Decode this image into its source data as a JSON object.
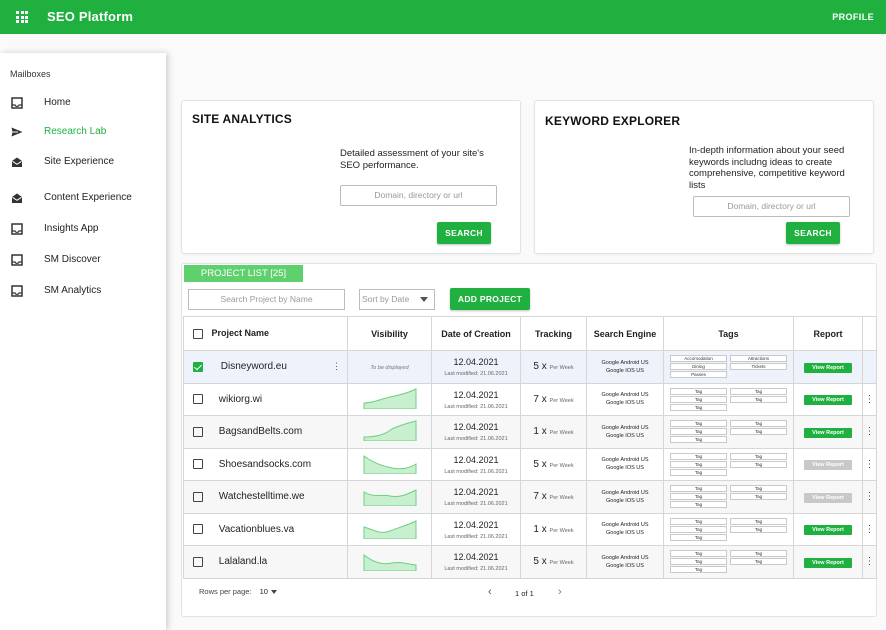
{
  "header": {
    "title": "SEO Platform",
    "profile": "PROFILE"
  },
  "sidebar": {
    "section": "Mailboxes",
    "items": [
      {
        "label": "Home",
        "icon": "inbox-icon"
      },
      {
        "label": "Research Lab",
        "icon": "send-icon",
        "active": true
      },
      {
        "label": "Site Experience",
        "icon": "drafts-icon"
      },
      {
        "label": "Content Experience",
        "icon": "drafts-icon"
      },
      {
        "label": "Insights App",
        "icon": "inbox-icon"
      },
      {
        "label": "SM Discover",
        "icon": "inbox-icon"
      },
      {
        "label": "SM Analytics",
        "icon": "inbox-icon"
      }
    ]
  },
  "site_analytics": {
    "title": "SITE ANALYTICS",
    "description": "Detailed assessment of your site's SEO performance.",
    "placeholder": "Domain, directory or url",
    "button": "SEARCH"
  },
  "keyword_explorer": {
    "title": "KEYWORD EXPLORER",
    "description": "In-depth information about your seed keywords includng ideas to create comprehensive, competitive keyword lists",
    "placeholder": "Domain, directory or url",
    "button": "SEARCH"
  },
  "projects": {
    "tab": "PROJECT LIST [25]",
    "search_placeholder": "Search Project by Name",
    "sort_label": "Sort by Date",
    "add_button": "ADD PROJECT",
    "columns": [
      "Project Name",
      "Visibility",
      "Date of Creation",
      "Tracking",
      "Search Engine",
      "Tags",
      "Report"
    ],
    "rows": [
      {
        "name": "Disneyword.eu",
        "visibility": "To be displayed",
        "date": "12.04.2021",
        "modified": "Last modified: 21.06.2021",
        "tracking": "5 x",
        "per": "Per Week",
        "engine1": "Google Android US",
        "engine2": "Google IOS US",
        "tags": [
          "Accomodation",
          "Attractions",
          "Dining",
          "Tickets",
          "Passes"
        ],
        "report": "View Report"
      },
      {
        "name": "wikiorg.wi",
        "date": "12.04.2021",
        "modified": "Last modified: 21.06.2021",
        "tracking": "7 x",
        "per": "Per Week",
        "engine1": "Google Android US",
        "engine2": "Google IOS US",
        "tags": [
          "Tag",
          "Tag",
          "Tag",
          "Tag",
          "Tag"
        ],
        "report": "View Report"
      },
      {
        "name": "BagsandBelts.com",
        "date": "12.04.2021",
        "modified": "Last modified: 21.06.2021",
        "tracking": "1 x",
        "per": "Per Week",
        "engine1": "Google Android US",
        "engine2": "Google IOS US",
        "tags": [
          "Tag",
          "Tag",
          "Tag",
          "Tag",
          "Tag"
        ],
        "report": "View Report"
      },
      {
        "name": "Shoesandsocks.com",
        "date": "12.04.2021",
        "modified": "Last modified: 21.06.2021",
        "tracking": "5 x",
        "per": "Per Week",
        "engine1": "Google Android US",
        "engine2": "Google IOS US",
        "tags": [
          "Tag",
          "Tag",
          "Tag",
          "Tag",
          "Tag"
        ],
        "report": "View Report",
        "report_disabled": true
      },
      {
        "name": "Watchestelltime.we",
        "date": "12.04.2021",
        "modified": "Last modified: 21.06.2021",
        "tracking": "7 x",
        "per": "Per Week",
        "engine1": "Google Android US",
        "engine2": "Google IOS US",
        "tags": [
          "Tag",
          "Tag",
          "Tag",
          "Tag",
          "Tag"
        ],
        "report": "View Report",
        "report_disabled": true
      },
      {
        "name": "Vacationblues.va",
        "date": "12.04.2021",
        "modified": "Last modified: 21.06.2021",
        "tracking": "1 x",
        "per": "Per Week",
        "engine1": "Google Android US",
        "engine2": "Google IOS US",
        "tags": [
          "Tag",
          "Tag",
          "Tag",
          "Tag",
          "Tag"
        ],
        "report": "View Report"
      },
      {
        "name": "Lalaland.la",
        "date": "12.04.2021",
        "modified": "Last modified: 21.06.2021",
        "tracking": "5 x",
        "per": "Per Week",
        "engine1": "Google Android US",
        "engine2": "Google IOS US",
        "tags": [
          "Tag",
          "Tag",
          "Tag",
          "Tag",
          "Tag"
        ],
        "report": "View Report"
      }
    ]
  },
  "pagination": {
    "rows_label": "Rows per page:",
    "rows_value": "10",
    "page_text": "1 of 1"
  },
  "colors": {
    "brand": "#1fb040",
    "tab": "#5fd06e",
    "disabled": "#c8c8c8"
  }
}
